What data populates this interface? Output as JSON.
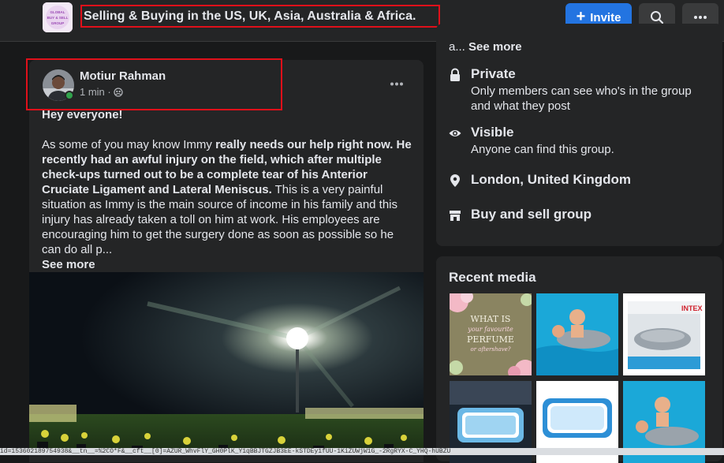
{
  "header": {
    "group_logo_text": [
      "GLOBAL",
      "BUY & SELL",
      "GROUP"
    ],
    "group_title": "Selling & Buying in the US, UK, Asia, Australia & Africa.",
    "invite_label": "Invite",
    "brand_color": "#2374e1",
    "highlight_color": "#e0101a"
  },
  "post": {
    "author": "Motiur Rahman",
    "time": "1 min · ",
    "privacy_icon": "group-audience-icon",
    "greeting": "Hey everyone!",
    "body_intro": "As some of you may know Immy ",
    "body_bold_1": "really needs our help right now. He recently had an awful injury on the field, which after multiple check-ups turned out to be a complete tear of his Anterior Cruciate Ligament and Lateral Meniscus.",
    "body_rest": " This is a very painful situation as Immy is the main source of income in his family and this injury has already taken a toll on him at work. His employees are encouraging him to get the surgery done as soon as possible so he can do all p...",
    "see_more": "See more"
  },
  "about": {
    "truncated_prefix": "a... ",
    "see_more": "See more",
    "items": [
      {
        "icon": "lock-icon",
        "title": "Private",
        "subtitle": "Only members can see who's in the group and what they post"
      },
      {
        "icon": "eye-icon",
        "title": "Visible",
        "subtitle": "Anyone can find this group."
      },
      {
        "icon": "location-pin-icon",
        "title": "London, United Kingdom",
        "subtitle": ""
      },
      {
        "icon": "shop-icon",
        "title": "Buy and sell group",
        "subtitle": ""
      }
    ]
  },
  "recent_media": {
    "title": "Recent media",
    "perfume_card_text": [
      "WHAT IS",
      "your favourite",
      "PERFUME",
      "or aftershave?"
    ],
    "pool_brand_text": "INTEX"
  },
  "status_bar": {
    "text": "id=153602189754938&__tn__=%2CO*F&__cft__[0]=AZUR_WhvFlY_GH0PlK_Y1qBBJTGZJB3EE-kSTDEy1fUU-1KiZUWjW1G_-2RgRYX-C_YHQ-hUBZU"
  }
}
